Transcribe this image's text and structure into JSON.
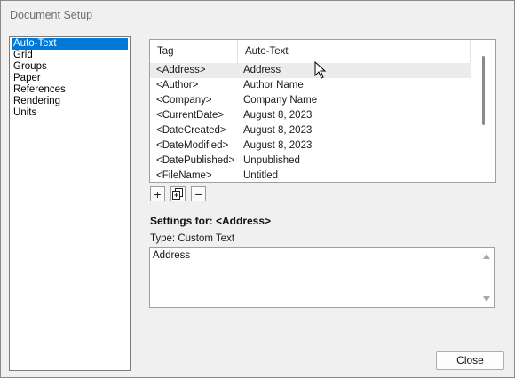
{
  "window": {
    "title": "Document Setup"
  },
  "categories": {
    "items": [
      {
        "label": "Auto-Text",
        "selected": true
      },
      {
        "label": "Grid",
        "selected": false
      },
      {
        "label": "Groups",
        "selected": false
      },
      {
        "label": "Paper",
        "selected": false
      },
      {
        "label": "References",
        "selected": false
      },
      {
        "label": "Rendering",
        "selected": false
      },
      {
        "label": "Units",
        "selected": false
      }
    ]
  },
  "auto_text_table": {
    "headers": {
      "tag": "Tag",
      "auto_text": "Auto-Text"
    },
    "rows": [
      {
        "tag": "<Address>",
        "value": "Address",
        "selected": true
      },
      {
        "tag": "<Author>",
        "value": "Author Name",
        "selected": false
      },
      {
        "tag": "<Company>",
        "value": "Company Name",
        "selected": false
      },
      {
        "tag": "<CurrentDate>",
        "value": "August 8, 2023",
        "selected": false
      },
      {
        "tag": "<DateCreated>",
        "value": "August 8, 2023",
        "selected": false
      },
      {
        "tag": "<DateModified>",
        "value": "August 8, 2023",
        "selected": false
      },
      {
        "tag": "<DatePublished>",
        "value": "Unpublished",
        "selected": false
      },
      {
        "tag": "<FileName>",
        "value": "Untitled",
        "selected": false
      }
    ]
  },
  "toolbar": {
    "add_glyph": "+",
    "remove_glyph": "−",
    "icons": [
      "add-icon",
      "duplicate-icon",
      "remove-icon"
    ]
  },
  "settings": {
    "label": "Settings for: <Address>",
    "type_label": "Type: Custom Text",
    "value": "Address"
  },
  "buttons": {
    "close_label": "Close"
  },
  "colors": {
    "selection": "#0078d7",
    "row_highlight": "#ececec"
  }
}
